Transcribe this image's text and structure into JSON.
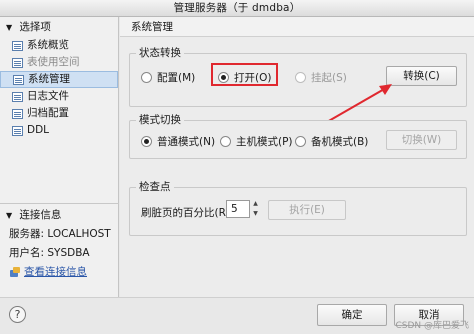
{
  "window": {
    "title": "管理服务器（于 dmdba）"
  },
  "sidebar": {
    "section_options": "选择项",
    "items": [
      {
        "label": "系统概览",
        "state": "normal"
      },
      {
        "label": "表使用空间",
        "state": "disabled"
      },
      {
        "label": "系统管理",
        "state": "selected"
      },
      {
        "label": "日志文件",
        "state": "normal"
      },
      {
        "label": "归档配置",
        "state": "normal"
      },
      {
        "label": "DDL",
        "state": "normal"
      }
    ],
    "section_connection": "连接信息",
    "server_line": "服务器: LOCALHOST",
    "user_line": "用户名: SYSDBA",
    "view_link": "查看连接信息"
  },
  "main": {
    "header": "系统管理",
    "state_group": {
      "title": "状态转换",
      "options": [
        {
          "label": "配置(M)",
          "checked": false,
          "disabled": false
        },
        {
          "label": "打开(O)",
          "checked": true,
          "disabled": false
        },
        {
          "label": "挂起(S)",
          "checked": false,
          "disabled": true
        }
      ],
      "button": "转换(C)"
    },
    "mode_group": {
      "title": "模式切换",
      "options": [
        {
          "label": "普通模式(N)",
          "checked": true
        },
        {
          "label": "主机模式(P)",
          "checked": false
        },
        {
          "label": "备机模式(B)",
          "checked": false
        }
      ],
      "button": "切换(W)"
    },
    "checkpoint_group": {
      "title": "检查点",
      "label": "刷脏页的百分比(R):",
      "value": "5",
      "button": "执行(E)"
    }
  },
  "footer": {
    "help": "?",
    "ok": "确定",
    "cancel": "取消",
    "watermark": "CSDN @库巴爱飞"
  },
  "colors": {
    "highlight": "#e0282f",
    "selection": "#cfe0f3",
    "link": "#2a56a8"
  }
}
